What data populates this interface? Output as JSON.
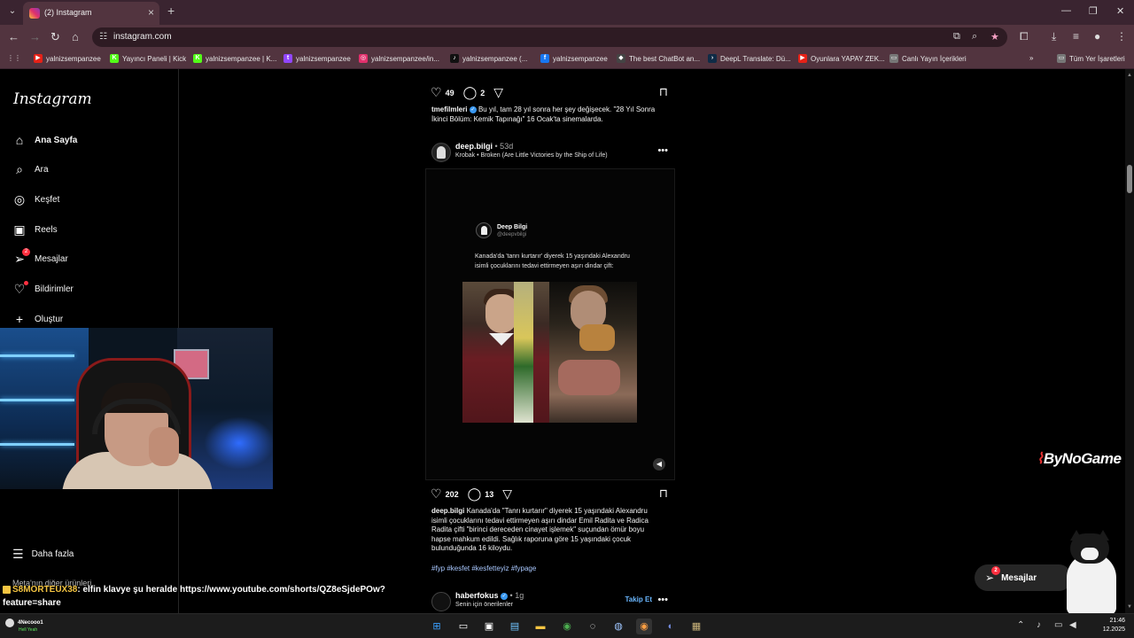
{
  "browser": {
    "tab_title": "(2) Instagram",
    "url": "instagram.com",
    "bookmarks": [
      {
        "label": "yalnizsempanzee",
        "color": "#e62117",
        "icon": "youtube-icon"
      },
      {
        "label": "Yayıncı Paneli | Kick",
        "color": "#53fc18",
        "icon": "kick-icon"
      },
      {
        "label": "yalnizsempanzee | K...",
        "color": "#53fc18",
        "icon": "kick-icon"
      },
      {
        "label": "yalnizsempanzee",
        "color": "#9146ff",
        "icon": "twitch-icon"
      },
      {
        "label": "yalnizsempanzee/in...",
        "color": "#e1306c",
        "icon": "instagram-icon"
      },
      {
        "label": "yalnizsempanzee (...",
        "color": "#111111",
        "icon": "tiktok-icon"
      },
      {
        "label": "yalnizsempanzee",
        "color": "#1877f2",
        "icon": "facebook-icon"
      },
      {
        "label": "The best ChatBot an...",
        "color": "#444444",
        "icon": "chatbot-icon"
      },
      {
        "label": "DeepL Translate: Dü...",
        "color": "#0f2b46",
        "icon": "deepl-icon"
      },
      {
        "label": "Oyunlara YAPAY ZEK...",
        "color": "#e62117",
        "icon": "youtube-icon"
      },
      {
        "label": "Canlı Yayın İçerikleri",
        "color": "#777777",
        "icon": "folder-icon"
      }
    ],
    "all_bookmarks": "Tüm Yer İşaretleri"
  },
  "sidebar": {
    "logo": "Instagram",
    "items": [
      {
        "label": "Ana Sayfa",
        "icon": "home-icon"
      },
      {
        "label": "Ara",
        "icon": "search-icon"
      },
      {
        "label": "Keşfet",
        "icon": "compass-icon"
      },
      {
        "label": "Reels",
        "icon": "reels-icon"
      },
      {
        "label": "Mesajlar",
        "icon": "messenger-icon",
        "badge": "2"
      },
      {
        "label": "Bildirimler",
        "icon": "heart-icon"
      },
      {
        "label": "Oluştur",
        "icon": "plus-icon"
      }
    ],
    "more": "Daha fazla",
    "meta": "Meta'nın diğer ürünleri"
  },
  "feed": {
    "prev_post": {
      "likes": "49",
      "comments": "2",
      "username": "tmefilmleri",
      "caption": "Bu yıl, tam 28 yıl sonra her şey değişecek. \"28 Yıl Sonra İkinci Bölüm: Kemik Tapınağı\" 16 Ocak'ta sinemalarda."
    },
    "post": {
      "username": "deep.bilgi",
      "time": "• 53d",
      "audio": "Krobak • Broken (Are Little Victories by the Ship of Life)",
      "tweet_name": "Deep Bilgi",
      "tweet_handle": "@deepvbilgi",
      "tweet_text": "Kanada'da 'tanrı kurtarır' diyerek 15 yaşındaki Alexandru isimli çocuklarını tedavi ettirmeyen aşırı dindar çift:",
      "likes": "202",
      "comments": "13",
      "caption": "Kanada'da \"Tanrı kurtarır\" diyerek 15 yaşındaki Alexandru isimli çocuklarını tedavi ettirmeyen aşırı dindar Emil Radita ve Radica Radita çifti \"birinci dereceden cinayet işlemek\" suçundan ömür boyu hapse mahkum edildi. Sağlık raporuna göre 15 yaşındaki çocuk bulunduğunda 16 kiloydu.",
      "hashtags": "#fyp #kesfet #kesfetteyiz #fypage"
    },
    "next_post": {
      "username": "haberfokus",
      "time": "• 1g",
      "subtitle": "Senin için önerilenler",
      "follow": "Takip Et"
    }
  },
  "messages_pill": {
    "label": "Mesajlar",
    "badge": "2"
  },
  "overlay": {
    "brand": "ByNoGame",
    "chat_user": "S8MORTEUX38",
    "chat_text": ": elfin klavye şu heralde https://www.youtube.com/shorts/QZ8eSjdePOw?feature=share"
  },
  "taskbar": {
    "user_name": "4Necooo1",
    "user_status": "Hell Yeah",
    "time": "21:46",
    "date": "12.2025"
  }
}
